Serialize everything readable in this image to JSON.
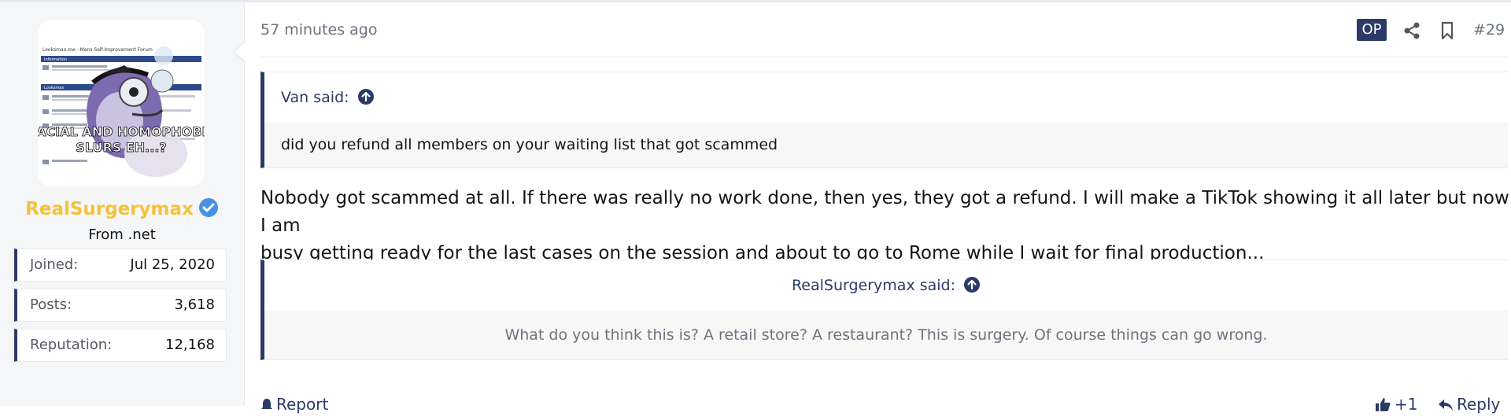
{
  "user": {
    "name": "RealSurgerymax",
    "title": "From .net",
    "avatar": {
      "forum_title": "Looksmax.me - Mens Self-Improvement Forum",
      "section_1": "Information",
      "section_2": "Looksmax",
      "caption_line_1": "RACIAL AND HOMOPHOBIC",
      "caption_line_2": "SLURS EH...?"
    },
    "stats": [
      {
        "key": "Joined:",
        "value": "Jul 25, 2020"
      },
      {
        "key": "Posts:",
        "value": "3,618"
      },
      {
        "key": "Reputation:",
        "value": "12,168"
      }
    ]
  },
  "post": {
    "time": "57 minutes ago",
    "op_badge": "OP",
    "number": "#29",
    "quote_1": {
      "author_line": "Van said:",
      "text": "did you refund all members on your waiting list that got scammed"
    },
    "message_line_1": "Nobody got scammed at all. If there was really no work done, then yes, they got a refund. I will make a TikTok showing it all later but now I am",
    "message_line_2": "busy getting ready for the last cases on the session and about to go to Rome while I wait for final production...",
    "quote_2": {
      "author_line": "RealSurgerymax said:",
      "text": "What do you think this is? A retail store? A restaurant? This is surgery. Of course things can go wrong."
    },
    "footer": {
      "report": "Report",
      "like": "+1",
      "reply": "Reply"
    }
  },
  "colors": {
    "accent": "#2b3a67",
    "username": "#f3c23c",
    "verified": "#4a90e2",
    "sidebar_bg": "#f5f6f8",
    "quote_body_bg": "#f7f7f8"
  }
}
